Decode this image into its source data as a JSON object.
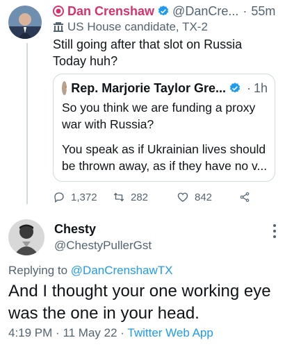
{
  "tweet1": {
    "author_name": "Dan Crenshaw",
    "handle": "@DanCre...",
    "time": "55m",
    "label": "US House candidate, TX-2",
    "text": "Still going after that slot on Russia Today huh?",
    "name_color": "#d6336c",
    "icons": [
      "record-icon",
      "verified-icon",
      "government-building-icon"
    ]
  },
  "quoted_tweet": {
    "author_name": "Rep. Marjorie Taylor Gre...",
    "time": "1h",
    "paragraph1": "So you think we are funding a proxy war with Russia?",
    "paragraph2": "You speak as if Ukrainian lives should be thrown away, as if they have no v..."
  },
  "actions": {
    "replies": "1,372",
    "retweets": "282",
    "likes": "842",
    "icons": [
      "reply-icon",
      "retweet-icon",
      "like-icon",
      "share-icon"
    ]
  },
  "tweet2": {
    "author_name": "Chesty",
    "handle": "@ChestyPullerGst",
    "replying_prefix": "Replying to",
    "replying_handle": "@DanCrenshawTX",
    "text": "And I thought your one working eye was the one in your head.",
    "time": "4:19 PM",
    "date": "11 May 22",
    "source": "Twitter Web App"
  },
  "colors": {
    "accent": "#1d9bf0",
    "muted": "#536471",
    "text": "#0f1419",
    "border": "#cfd9de"
  }
}
